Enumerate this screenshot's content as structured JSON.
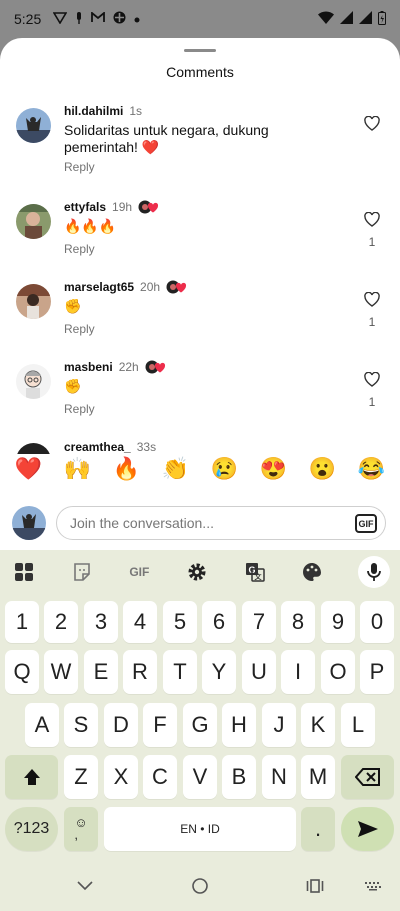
{
  "status_bar": {
    "time": "5:25"
  },
  "sheet": {
    "title": "Comments"
  },
  "comments": [
    {
      "user": "hil.dahilmi",
      "time": "1s",
      "text": "Solidaritas untuk negara, dukung pemerintah! ❤️",
      "reply": "Reply",
      "likes": ""
    },
    {
      "user": "ettyfals",
      "time": "19h",
      "text": "🔥🔥🔥",
      "reply": "Reply",
      "likes": "1"
    },
    {
      "user": "marselagt65",
      "time": "20h",
      "text": "✊",
      "reply": "Reply",
      "likes": "1"
    },
    {
      "user": "masbeni",
      "time": "22h",
      "text": "✊",
      "reply": "Reply",
      "likes": "1"
    },
    {
      "user": "creamthea_",
      "time": "33s",
      "text": "",
      "reply": "",
      "likes": ""
    }
  ],
  "reactions": [
    "❤️",
    "🙌",
    "🔥",
    "👏",
    "😢",
    "😍",
    "😮",
    "😂"
  ],
  "composer": {
    "placeholder": "Join the conversation...",
    "gif_label": "GIF"
  },
  "keyboard": {
    "toolbar": {
      "gif_label": "GIF"
    },
    "rows": [
      [
        "1",
        "2",
        "3",
        "4",
        "5",
        "6",
        "7",
        "8",
        "9",
        "0"
      ],
      [
        "Q",
        "W",
        "E",
        "R",
        "T",
        "Y",
        "U",
        "I",
        "O",
        "P"
      ],
      [
        "A",
        "S",
        "D",
        "F",
        "G",
        "H",
        "J",
        "K",
        "L"
      ],
      [
        "Z",
        "X",
        "C",
        "V",
        "B",
        "N",
        "M"
      ]
    ],
    "symbols_label": "?123",
    "emoji_comma_label": "☺\n,",
    "space_label": "EN • ID",
    "period_label": "."
  }
}
